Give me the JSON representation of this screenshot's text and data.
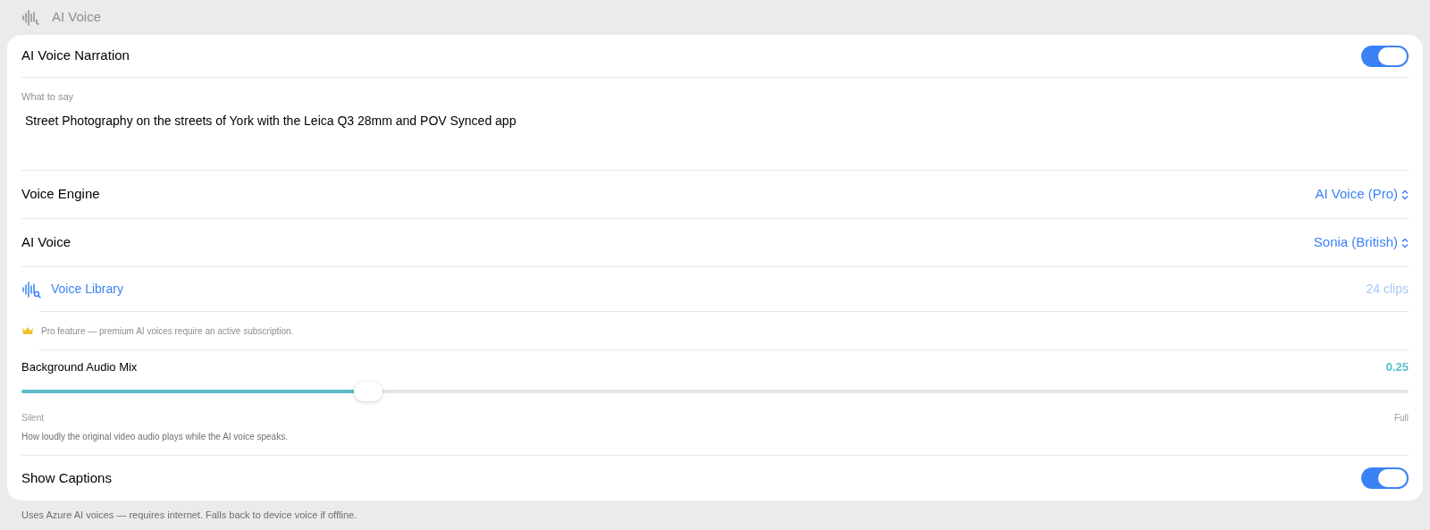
{
  "header": {
    "title": "AI Voice"
  },
  "narration": {
    "label": "AI Voice Narration",
    "on": true
  },
  "script_field": {
    "label": "What to say",
    "value": "Street Photography on the streets of York with the Leica Q3 28mm and POV Synced app"
  },
  "pickers": [
    {
      "label": "Voice Engine",
      "value": "AI Voice (Pro)"
    },
    {
      "label": "AI Voice",
      "value": "Sonia (British)"
    }
  ],
  "library": {
    "label": "Voice Library",
    "count": "24 clips"
  },
  "pro_note": "Pro feature — premium AI voices require an active subscription.",
  "mix": {
    "label": "Background Audio Mix",
    "reading": "0.25",
    "level": 0.25,
    "min_label": "Silent",
    "max_label": "Full",
    "hint": "How loudly the original video audio plays while the AI voice speaks."
  },
  "captions": {
    "label": "Show Captions",
    "on": true
  },
  "footer": "Uses Azure AI voices — requires internet. Falls back to device voice if offline."
}
